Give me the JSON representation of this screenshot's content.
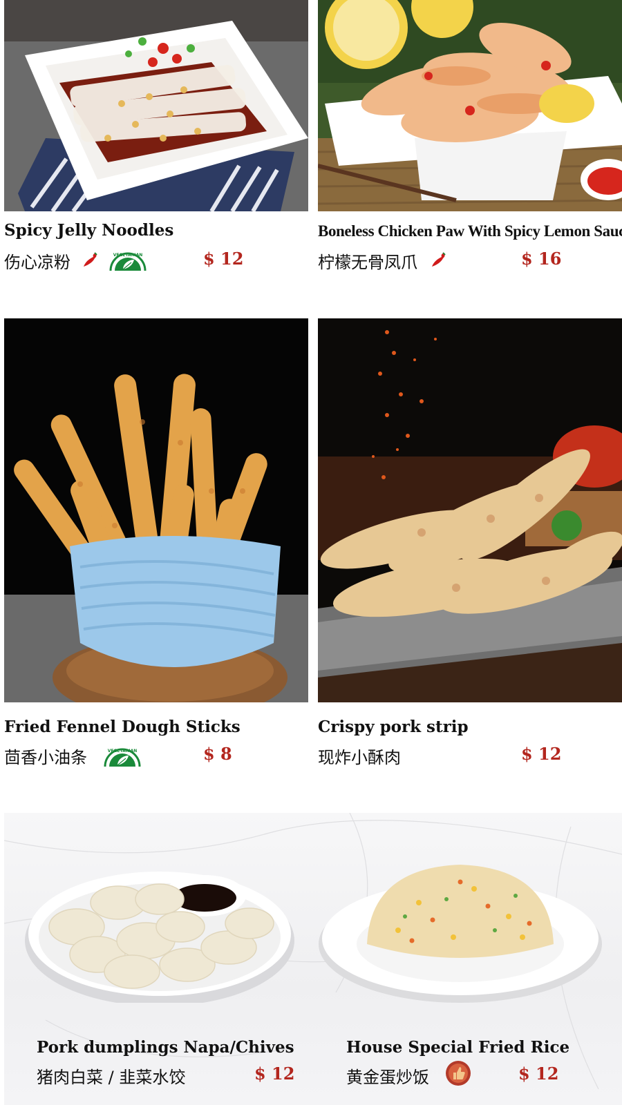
{
  "menu_items": [
    {
      "name": "Spicy Jelly Noodles",
      "name_cn": "伤心凉粉",
      "price": "$ 12",
      "spicy": true,
      "vegetarian": true,
      "image": "spicy-jelly-noodles-photo"
    },
    {
      "name": "Boneless Chicken Paw With Spicy Lemon Sauce",
      "name_cn": "柠檬无骨凤爪",
      "price": "$ 16",
      "spicy": true,
      "vegetarian": false,
      "image": "chicken-paw-photo"
    },
    {
      "name": "Fried Fennel Dough Sticks",
      "name_cn": "茴香小油条",
      "price": "$ 8",
      "spicy": false,
      "vegetarian": true,
      "image": "dough-sticks-photo"
    },
    {
      "name": "Crispy pork strip",
      "name_cn": "现炸小酥肉",
      "price": "$ 12",
      "spicy": false,
      "vegetarian": false,
      "image": "crispy-pork-photo"
    },
    {
      "name": "Pork dumplings Napa/Chives",
      "name_cn": "猪肉白菜 / 韭菜水饺",
      "price": "$ 12",
      "spicy": false,
      "vegetarian": false,
      "image": "dumplings-photo"
    },
    {
      "name": "House Special Fried Rice",
      "name_cn": "黄金蛋炒饭",
      "price": "$ 12",
      "spicy": false,
      "vegetarian": false,
      "recommended": true,
      "image": "fried-rice-photo"
    }
  ],
  "badges": {
    "vegetarian_label": "VEGETARIAN"
  },
  "colors": {
    "price": "#b3261e",
    "vegetarian": "#1a8a3a",
    "chili": "#d01b1b",
    "recommend": "#b23a2a"
  }
}
